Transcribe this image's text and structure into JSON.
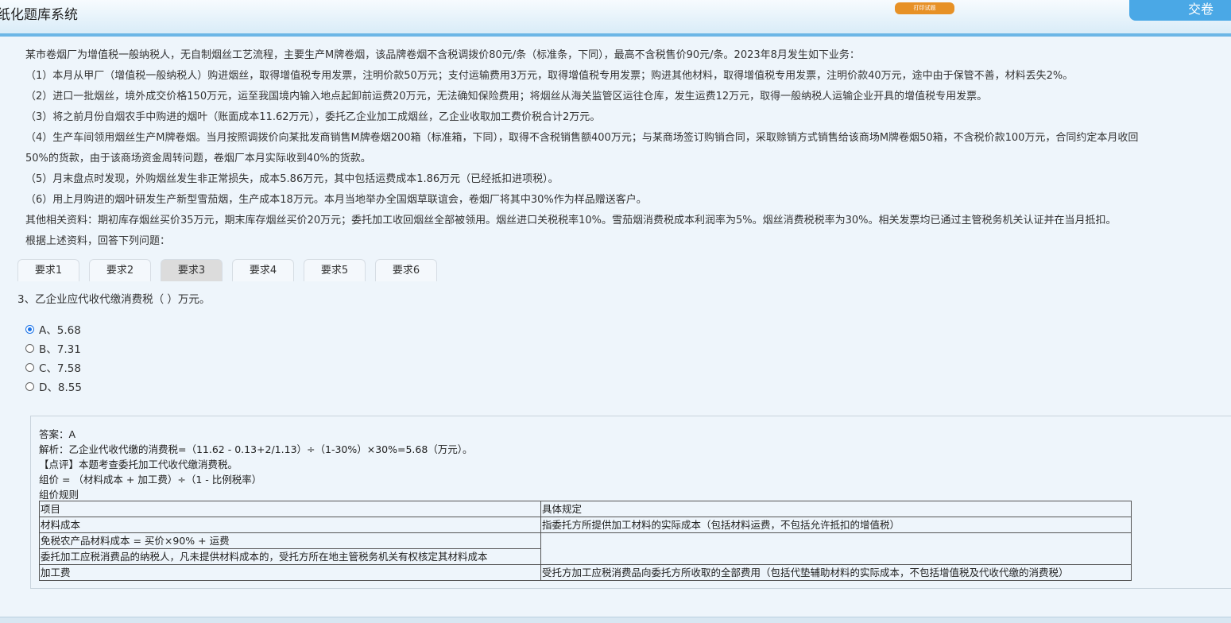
{
  "header": {
    "app_title": "纸化题库系统",
    "print_label": "打印试题",
    "submit_label": "交卷"
  },
  "stem": {
    "paragraphs": [
      "某市卷烟厂为增值税一般纳税人，无自制烟丝工艺流程，主要生产M牌卷烟，该品牌卷烟不含税调拨价80元/条（标准条，下同），最高不含税售价90元/条。2023年8月发生如下业务：",
      "（1）本月从甲厂（增值税一般纳税人）购进烟丝，取得增值税专用发票，注明价款50万元；支付运输费用3万元，取得增值税专用发票；购进其他材料，取得增值税专用发票，注明价款40万元，途中由于保管不善，材料丢失2%。",
      "（2）进口一批烟丝，境外成交价格150万元，运至我国境内输入地点起卸前运费20万元，无法确知保险费用；将烟丝从海关监管区运往仓库，发生运费12万元，取得一般纳税人运输企业开具的增值税专用发票。",
      "（3）将之前月份自烟农手中购进的烟叶（账面成本11.62万元），委托乙企业加工成烟丝，乙企业收取加工费价税合计2万元。",
      "（4）生产车间领用烟丝生产M牌卷烟。当月按照调拨价向某批发商销售M牌卷烟200箱（标准箱，下同），取得不含税销售额400万元；与某商场签订购销合同，采取赊销方式销售给该商场M牌卷烟50箱，不含税价款100万元，合同约定本月收回",
      "50%的货款，由于该商场资金周转问题，卷烟厂本月实际收到40%的货款。",
      "（5）月末盘点时发现，外购烟丝发生非正常损失，成本5.86万元，其中包括运费成本1.86万元（已经抵扣进项税）。",
      "（6）用上月购进的烟叶研发生产新型雪茄烟，生产成本18万元。本月当地举办全国烟草联谊会，卷烟厂将其中30%作为样品赠送客户。",
      "其他相关资料：期初库存烟丝买价35万元，期末库存烟丝买价20万元；委托加工收回烟丝全部被领用。烟丝进口关税税率10%。雪茄烟消费税成本利润率为5%。烟丝消费税税率为30%。相关发票均已通过主管税务机关认证并在当月抵扣。",
      "根据上述资料，回答下列问题："
    ]
  },
  "tabs": [
    "要求1",
    "要求2",
    "要求3",
    "要求4",
    "要求5",
    "要求6"
  ],
  "active_tab": "要求3",
  "question": {
    "text": "3、乙企业应代收代缴消费税（    ）万元。",
    "options": [
      "A、5.68",
      "B、7.31",
      "C、7.58",
      "D、8.55"
    ],
    "selected": "A、5.68"
  },
  "answer": {
    "lines": [
      "答案：A",
      "解析：乙企业代收代缴的消费税=（11.62 - 0.13+2/1.13）÷（1-30%）×30%=5.68（万元）。",
      "【点评】本题考查委托加工代收代缴消费税。",
      "组价 = （材料成本 + 加工费）÷（1 - 比例税率）",
      "组价规则"
    ],
    "table": {
      "header": [
        "项目",
        "具体规定"
      ],
      "rows": [
        [
          "材料成本",
          "指委托方所提供加工材料的实际成本（包括材料运费，不包括允许抵扣的增值税）"
        ],
        [
          "免税农产品材料成本 = 买价×90% + 运费",
          ""
        ],
        [
          "委托加工应税消费品的纳税人，凡未提供材料成本的，受托方所在地主管税务机关有权核定其材料成本",
          ""
        ],
        [
          "加工费",
          "受托方加工应税消费品向委托方所收取的全部费用（包括代垫辅助材料的实际成本，不包括增值税及代收代缴的消费税）"
        ]
      ]
    }
  },
  "colors": {
    "header_border": "#6cb6e6",
    "submit_button": "#4aa8e6",
    "print_button": "#e79126",
    "active_tab": "#dcdcdc",
    "background": "#eef5fb"
  }
}
